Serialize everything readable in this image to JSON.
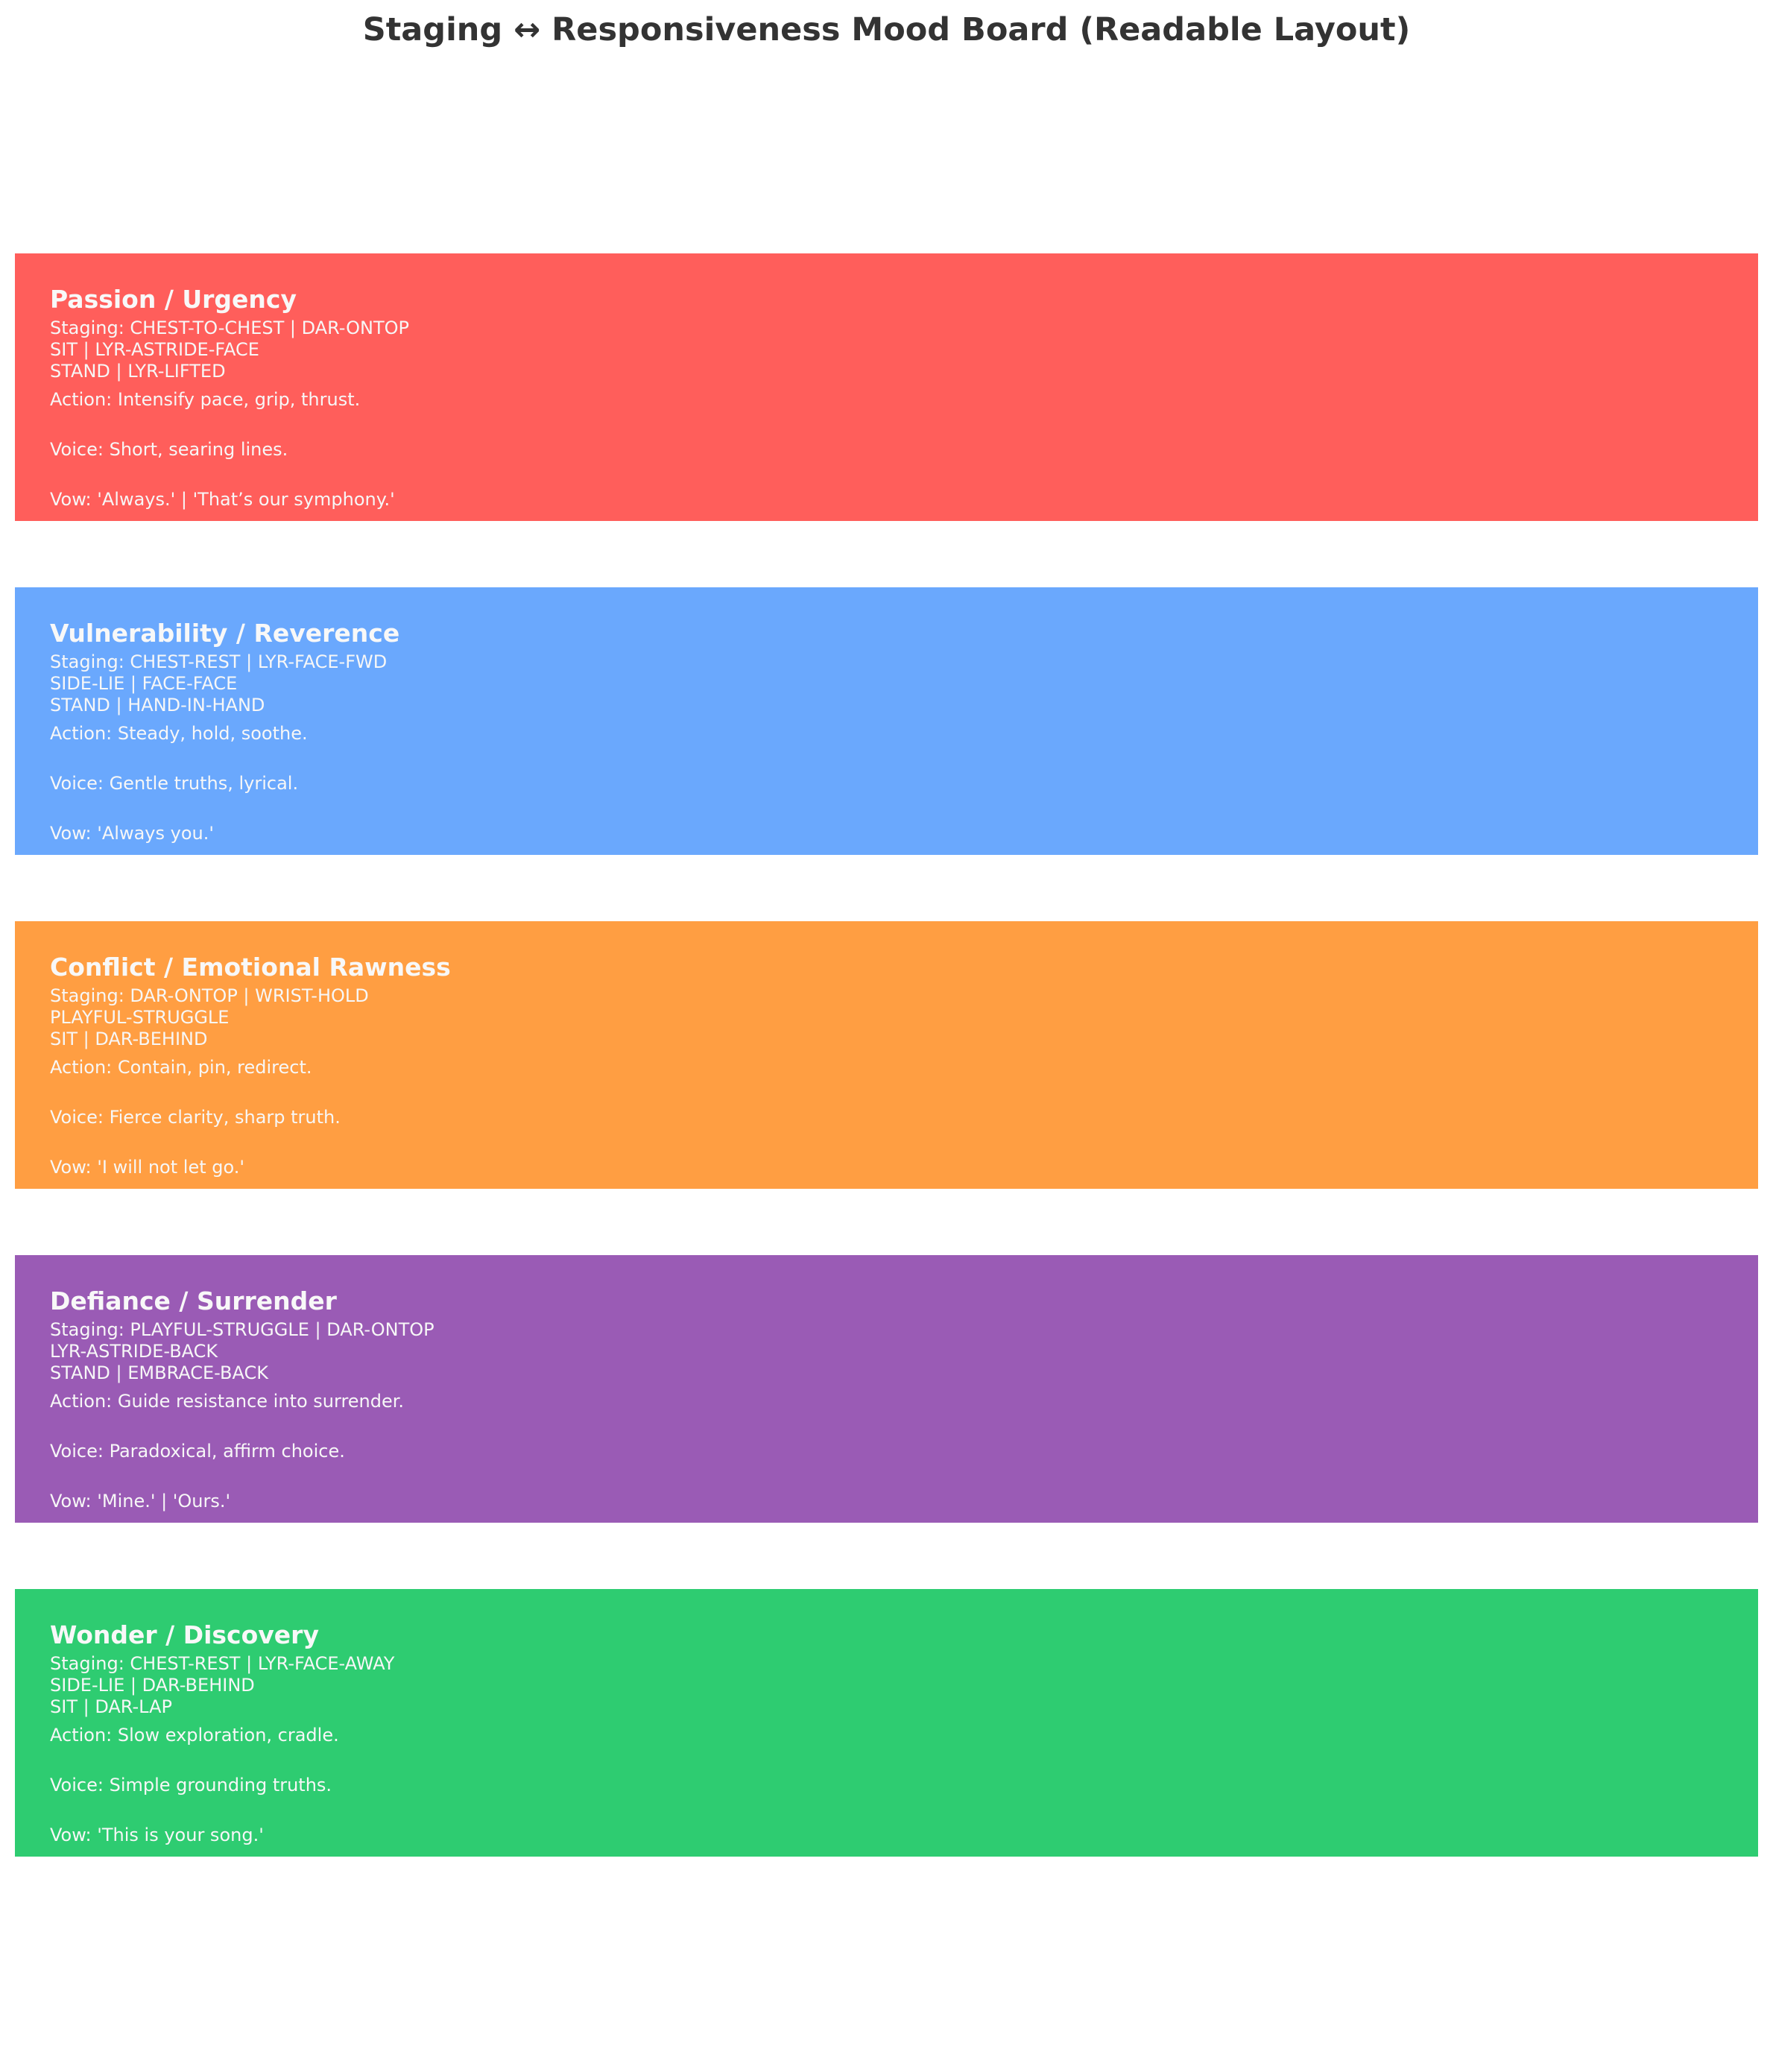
{
  "title": "Staging ↔ Responsiveness Mood Board (Readable Layout)",
  "panels": [
    {
      "heading": "Passion / Urgency",
      "color": "#ff5e5b",
      "staging": [
        "Staging: CHEST-TO-CHEST | DAR-ONTOP",
        "SIT | LYR-ASTRIDE-FACE",
        "STAND | LYR-LIFTED"
      ],
      "action": "Action: Intensify pace, grip, thrust.",
      "voice": "Voice: Short, searing lines.",
      "vow": "Vow: 'Always.' | 'That’s our symphony.'"
    },
    {
      "heading": "Vulnerability / Reverence",
      "color": "#6aa8fd",
      "staging": [
        "Staging: CHEST-REST | LYR-FACE-FWD",
        "SIDE-LIE | FACE-FACE",
        "STAND | HAND-IN-HAND"
      ],
      "action": "Action: Steady, hold, soothe.",
      "voice": "Voice: Gentle truths, lyrical.",
      "vow": "Vow: 'Always you.'"
    },
    {
      "heading": "Conflict / Emotional Rawness",
      "color": "#ff9e42",
      "staging": [
        "Staging: DAR-ONTOP | WRIST-HOLD",
        "PLAYFUL-STRUGGLE",
        "SIT | DAR-BEHIND"
      ],
      "action": "Action: Contain, pin, redirect.",
      "voice": "Voice: Fierce clarity, sharp truth.",
      "vow": "Vow: 'I will not let go.'"
    },
    {
      "heading": "Defiance / Surrender",
      "color": "#9a5bb5",
      "staging": [
        "Staging: PLAYFUL-STRUGGLE | DAR-ONTOP",
        "LYR-ASTRIDE-BACK",
        "STAND | EMBRACE-BACK"
      ],
      "action": "Action: Guide resistance into surrender.",
      "voice": "Voice: Paradoxical, affirm choice.",
      "vow": "Vow: 'Mine.' | 'Ours.'"
    },
    {
      "heading": "Wonder / Discovery",
      "color": "#2ecc71",
      "staging": [
        "Staging: CHEST-REST | LYR-FACE-AWAY",
        "SIDE-LIE | DAR-BEHIND",
        "SIT | DAR-LAP"
      ],
      "action": "Action: Slow exploration, cradle.",
      "voice": "Voice: Simple grounding truths.",
      "vow": "Vow: 'This is your song.'"
    }
  ]
}
